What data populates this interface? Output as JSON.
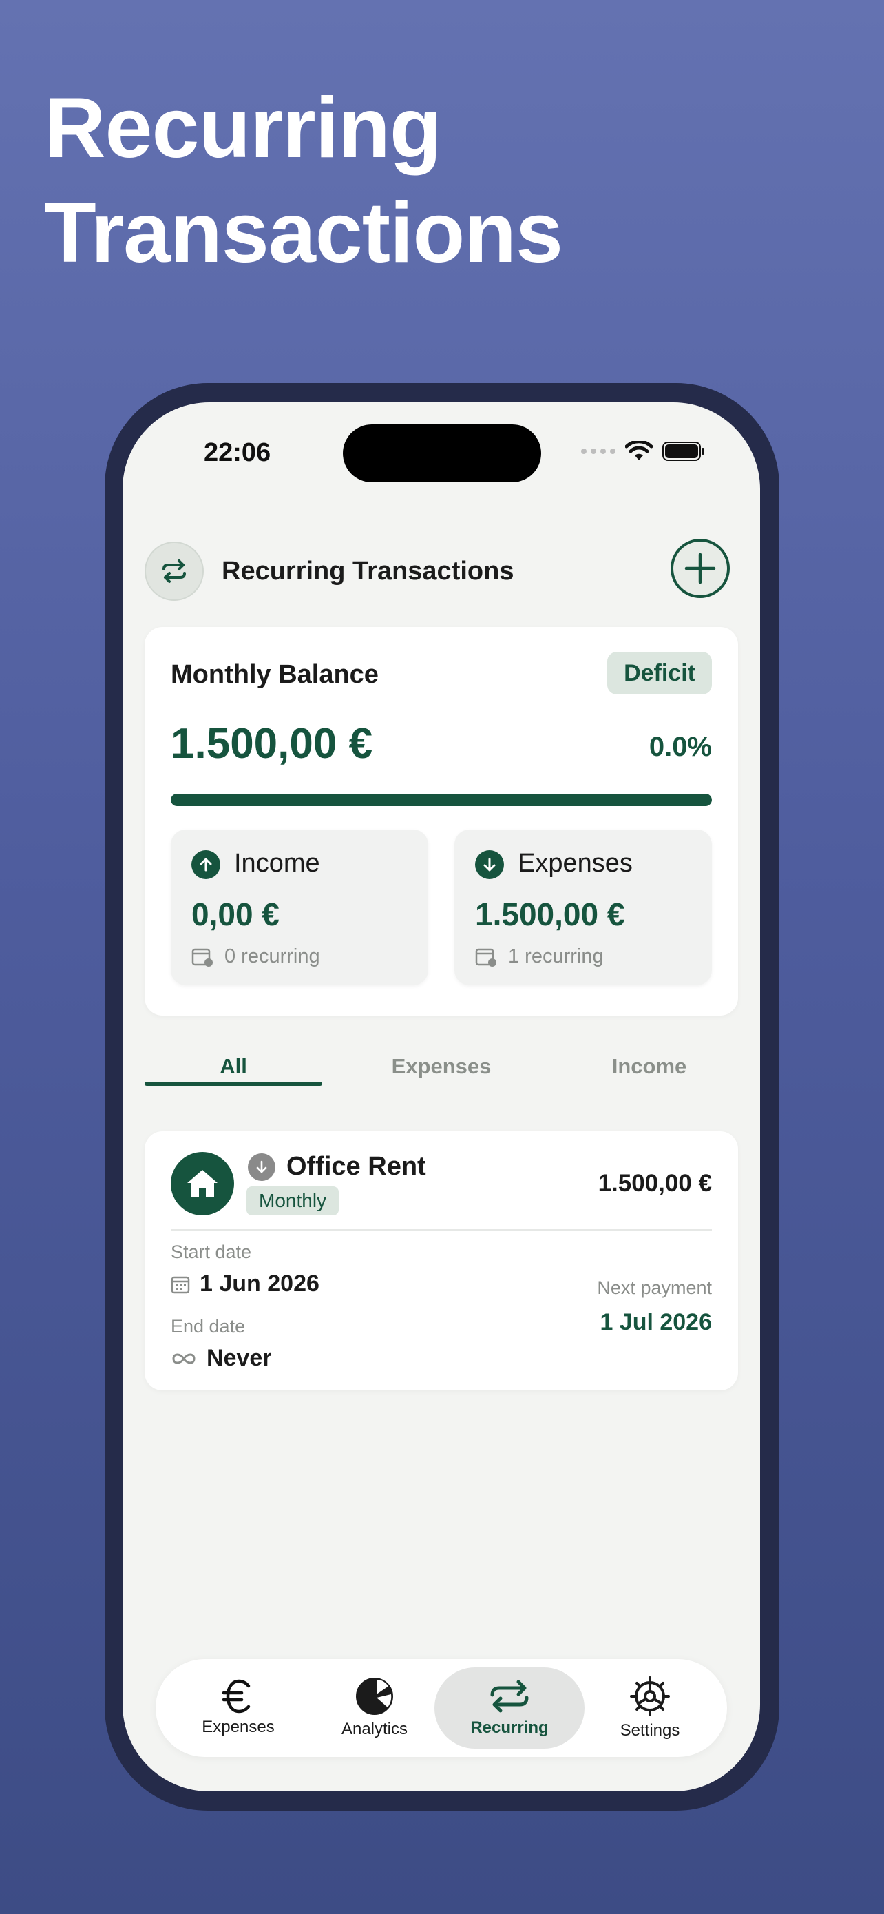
{
  "headline": {
    "line1": "Recurring",
    "line2": "Transactions"
  },
  "status_bar": {
    "time": "22:06"
  },
  "header": {
    "title": "Recurring Transactions"
  },
  "balance": {
    "title": "Monthly Balance",
    "badge": "Deficit",
    "amount": "1.500,00 €",
    "percent": "0.0%",
    "progress_fraction": 1.0,
    "income": {
      "label": "Income",
      "amount": "0,00 €",
      "recurring": "0 recurring"
    },
    "expenses": {
      "label": "Expenses",
      "amount": "1.500,00 €",
      "recurring": "1 recurring"
    }
  },
  "filter_tabs": [
    {
      "label": "All"
    },
    {
      "label": "Expenses"
    },
    {
      "label": "Income"
    }
  ],
  "transaction": {
    "name": "Office Rent",
    "frequency": "Monthly",
    "amount": "1.500,00 €",
    "start_label": "Start date",
    "start_value": "1 Jun 2026",
    "end_label": "End date",
    "end_value": "Never",
    "next_label": "Next payment",
    "next_value": "1 Jul 2026"
  },
  "tab_bar": [
    {
      "label": "Expenses",
      "icon": "euro-icon"
    },
    {
      "label": "Analytics",
      "icon": "pie-chart-icon"
    },
    {
      "label": "Recurring",
      "icon": "repeat-icon"
    },
    {
      "label": "Settings",
      "icon": "gear-icon"
    }
  ],
  "colors": {
    "accent": "#16543e",
    "background": "#6472b1",
    "screen": "#f3f4f2"
  }
}
